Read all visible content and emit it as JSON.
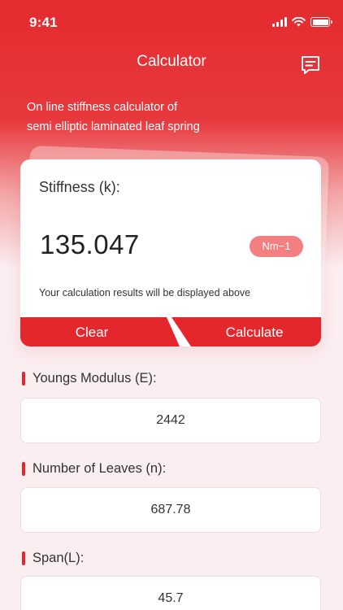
{
  "status_bar": {
    "time": "9:41"
  },
  "header": {
    "title": "Calculator"
  },
  "intro": {
    "line1": "On line stiffness calculator of",
    "line2": "semi elliptic laminated leaf  spring"
  },
  "result": {
    "label": "Stiffness (k):",
    "value": "135.047",
    "unit": "Nm−1",
    "hint": "Your calculation results will be displayed above"
  },
  "actions": {
    "clear_label": "Clear",
    "calculate_label": "Calculate"
  },
  "fields": [
    {
      "label": "Youngs Modulus (E):",
      "value": "2442"
    },
    {
      "label": "Number of Leaves (n):",
      "value": "687.78"
    },
    {
      "label": "Span(L):",
      "value": "45.7"
    }
  ],
  "colors": {
    "accent": "#e4272c",
    "badge": "#f47f80",
    "background": "#fbeef0"
  }
}
